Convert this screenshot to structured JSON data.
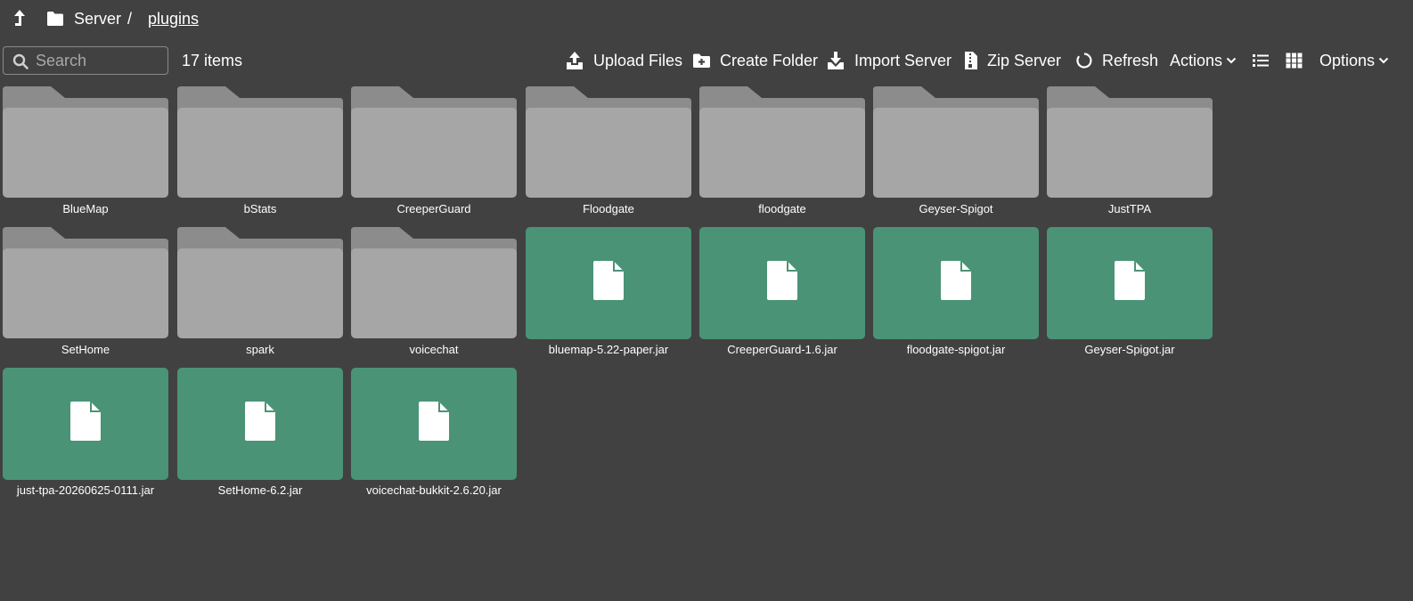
{
  "breadcrumb": {
    "root": "Server",
    "separator": "/",
    "current": "plugins"
  },
  "search": {
    "placeholder": "Search",
    "value": ""
  },
  "item_count": "17 items",
  "toolbar": {
    "upload": "Upload Files",
    "create_folder": "Create Folder",
    "import": "Import Server",
    "zip": "Zip Server",
    "refresh": "Refresh",
    "actions": "Actions",
    "options": "Options"
  },
  "colors": {
    "background": "#414141",
    "folder": "#a6a6a6",
    "folder_tab": "#8c8c8c",
    "file": "#4a9377"
  },
  "items": [
    {
      "name": "BlueMap",
      "type": "folder"
    },
    {
      "name": "bStats",
      "type": "folder"
    },
    {
      "name": "CreeperGuard",
      "type": "folder"
    },
    {
      "name": "Floodgate",
      "type": "folder"
    },
    {
      "name": "floodgate",
      "type": "folder"
    },
    {
      "name": "Geyser-Spigot",
      "type": "folder"
    },
    {
      "name": "JustTPA",
      "type": "folder"
    },
    {
      "name": "SetHome",
      "type": "folder"
    },
    {
      "name": "spark",
      "type": "folder"
    },
    {
      "name": "voicechat",
      "type": "folder"
    },
    {
      "name": "bluemap-5.22-paper.jar",
      "type": "file"
    },
    {
      "name": "CreeperGuard-1.6.jar",
      "type": "file"
    },
    {
      "name": "floodgate-spigot.jar",
      "type": "file"
    },
    {
      "name": "Geyser-Spigot.jar",
      "type": "file"
    },
    {
      "name": "just-tpa-20260625-0111.jar",
      "type": "file"
    },
    {
      "name": "SetHome-6.2.jar",
      "type": "file"
    },
    {
      "name": "voicechat-bukkit-2.6.20.jar",
      "type": "file"
    }
  ]
}
